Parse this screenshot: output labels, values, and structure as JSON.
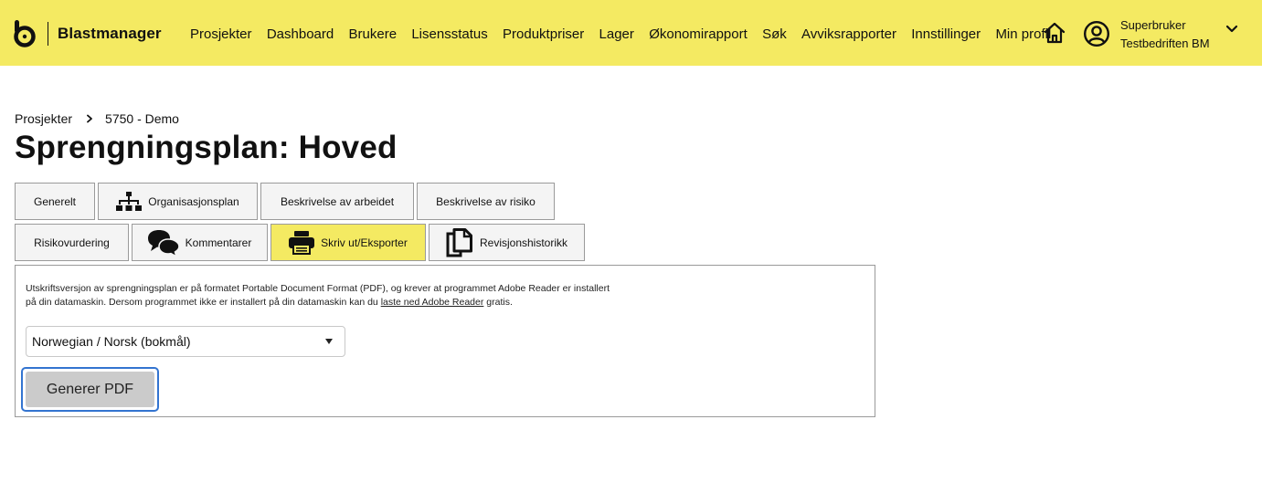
{
  "header": {
    "brand": "Blastmanager",
    "nav": [
      "Prosjekter",
      "Dashboard",
      "Brukere",
      "Lisensstatus",
      "Produktpriser",
      "Lager",
      "Økonomirapport",
      "Søk",
      "Avviksrapporter",
      "Innstillinger",
      "Min profil"
    ],
    "user": {
      "name": "Superbruker",
      "company": "Testbedriften BM"
    }
  },
  "breadcrumb": {
    "root": "Prosjekter",
    "current": "5750 - Demo"
  },
  "page_title": "Sprengningsplan: Hoved",
  "tabs_row1": [
    "Generelt",
    "Organisasjonsplan",
    "Beskrivelse av arbeidet",
    "Beskrivelse av risiko"
  ],
  "tabs_row2": [
    "Risikovurdering",
    "Kommentarer",
    "Skriv ut/Eksporter",
    "Revisjonshistorikk"
  ],
  "export_panel": {
    "info_line1": "Utskriftsversjon av sprengningsplan er på formatet Portable Document Format (PDF), og krever at programmet Adobe Reader er installert",
    "info_line2_pre": "på din datamaskin. Dersom programmet ikke er installert på din datamaskin kan du ",
    "info_link": "laste ned Adobe Reader",
    "info_line2_post": " gratis.",
    "language_selected": "Norwegian / Norsk (bokmål)",
    "generate_button": "Generer PDF"
  },
  "colors": {
    "header_bg": "#f4ea62",
    "active_tab_bg": "#f4ea62",
    "focus_ring": "#3374d0"
  }
}
